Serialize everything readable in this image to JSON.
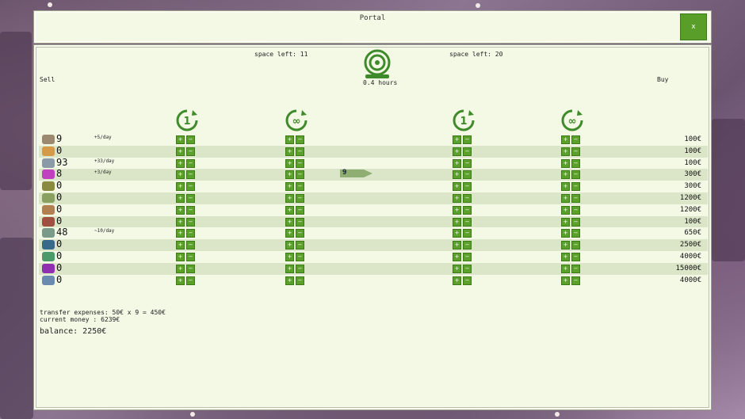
{
  "header": {
    "title": "Portal",
    "close_label": "x"
  },
  "panel": {
    "sell_label": "Sell",
    "buy_label": "Buy",
    "space_left_sell": "space left: 11",
    "space_left_buy": "space left: 20",
    "travel_time": "0.4 hours"
  },
  "colors": {
    "accent": "#5ba02a",
    "panel_bg": "#f4f9e6",
    "stripe": "#dbe6c8"
  },
  "column_icons": [
    "sell-once-icon",
    "sell-repeat-icon",
    "buy-once-icon",
    "buy-repeat-icon"
  ],
  "items": [
    {
      "icon": "feather-icon",
      "icon_color": "#9c8a70",
      "qty": "9",
      "rate": "+5/day",
      "price": "100€"
    },
    {
      "icon": "bread-icon",
      "icon_color": "#d49a4a",
      "qty": "0",
      "rate": "",
      "price": "100€"
    },
    {
      "icon": "robot-icon",
      "icon_color": "#8a9aa8",
      "qty": "93",
      "rate": "+33/day",
      "price": "100€"
    },
    {
      "icon": "magnet-icon",
      "icon_color": "#c040c0",
      "qty": "8",
      "rate": "+3/day",
      "price": "300€"
    },
    {
      "icon": "seed-icon",
      "icon_color": "#8a8a40",
      "qty": "0",
      "rate": "",
      "price": "300€"
    },
    {
      "icon": "plank-icon",
      "icon_color": "#8aa060",
      "qty": "0",
      "rate": "",
      "price": "1200€"
    },
    {
      "icon": "bug-icon",
      "icon_color": "#b08050",
      "qty": "0",
      "rate": "",
      "price": "1200€"
    },
    {
      "icon": "meat-icon",
      "icon_color": "#a05040",
      "qty": "0",
      "rate": "",
      "price": "100€"
    },
    {
      "icon": "paper-icon",
      "icon_color": "#7a9a8a",
      "qty": "48",
      "rate": "~10/day",
      "price": "650€"
    },
    {
      "icon": "eye-icon",
      "icon_color": "#3a6a8a",
      "qty": "0",
      "rate": "",
      "price": "2500€"
    },
    {
      "icon": "clock-icon",
      "icon_color": "#4a9a6a",
      "qty": "0",
      "rate": "",
      "price": "4000€"
    },
    {
      "icon": "gem-icon",
      "icon_color": "#9030b0",
      "qty": "0",
      "rate": "",
      "price": "15000€"
    },
    {
      "icon": "machine-icon",
      "icon_color": "#6a8ab0",
      "qty": "0",
      "rate": "",
      "price": "4000€"
    }
  ],
  "transfer": {
    "item_index": 3,
    "amount": "9"
  },
  "footer": {
    "transfer_expenses": "transfer expenses: 50€ x 9 = 450€",
    "current_money": "current money : 6239€",
    "balance": "balance: 2250€"
  }
}
